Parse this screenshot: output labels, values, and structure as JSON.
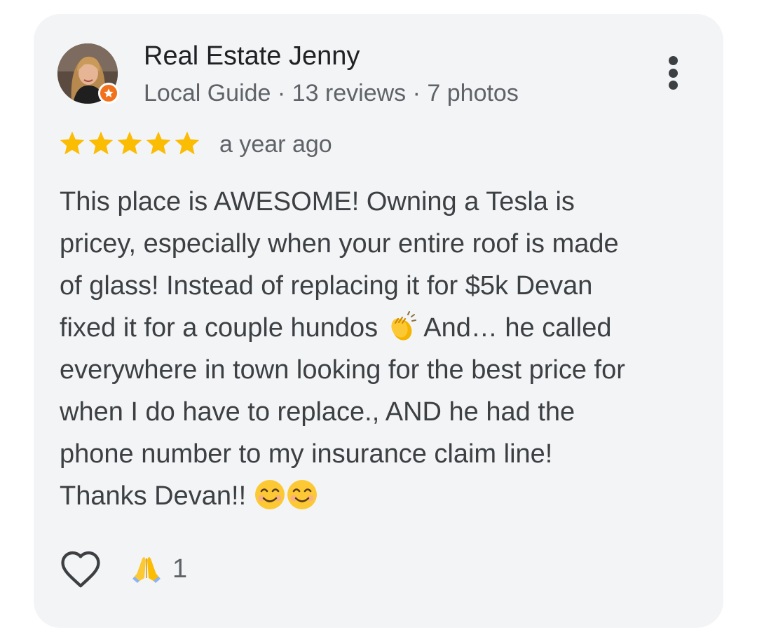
{
  "author": {
    "name": "Real Estate Jenny",
    "meta": "Local Guide · 13 reviews · 7 photos",
    "avatar_icon": "profile-photo",
    "badge_icon": "local-guide-star-icon",
    "badge_color": "#f2711c"
  },
  "menu": {
    "icon": "more-vert-icon"
  },
  "rating": {
    "stars": 5,
    "max_stars": 5,
    "star_color": "#fbbc04",
    "date": "a year ago"
  },
  "review": {
    "lines": [
      "This place is AWESOME! Owning a Tesla is",
      "pricey, especially when your entire roof is made",
      "of glass! Instead of replacing it for $5k Devan",
      "fixed it for a couple hundos",
      "And… he called",
      "everywhere in town looking for the best price for",
      "when I do have to replace., AND he had the",
      "phone number to my insurance claim line!",
      "Thanks Devan!!"
    ],
    "emojis": {
      "clap": "clapping-hands-emoji",
      "smile": "smiling-face-emoji"
    }
  },
  "actions": {
    "like_icon": "heart-outline-icon",
    "reaction_icon": "folded-hands-emoji",
    "reaction_count": "1"
  }
}
